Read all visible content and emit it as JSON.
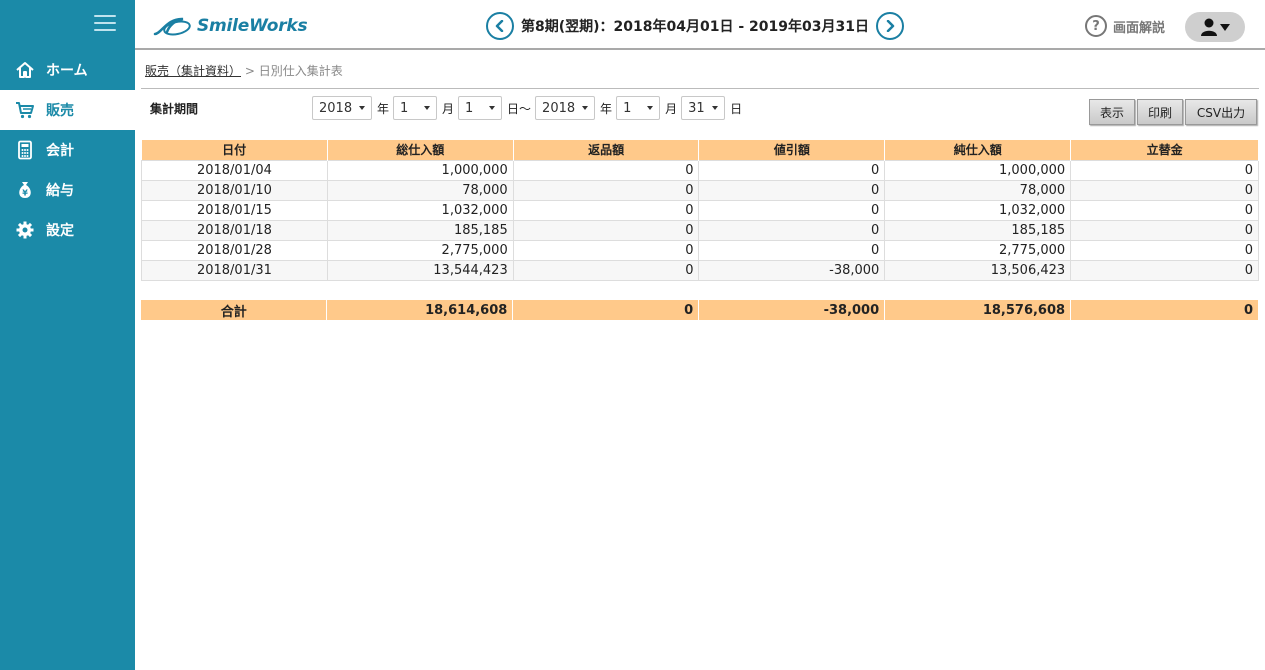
{
  "colors": {
    "sidebar": "#1b8aa8",
    "accent": "#1a7fa3",
    "table_header": "#ffc98a"
  },
  "brand": "SmileWorks",
  "period": "第8期(翌期)：2018年04月01日 - 2019年03月31日",
  "help_label": "画面解説",
  "nav": [
    {
      "label": "ホーム",
      "icon": "home-icon"
    },
    {
      "label": "販売",
      "icon": "cart-icon",
      "active": true
    },
    {
      "label": "会計",
      "icon": "calculator-icon"
    },
    {
      "label": "給与",
      "icon": "money-bag-icon"
    },
    {
      "label": "設定",
      "icon": "gear-icon"
    }
  ],
  "breadcrumb": {
    "parent": "販売（集計資料）",
    "sep": " > ",
    "current": "日別仕入集計表"
  },
  "filter": {
    "label": "集計期間",
    "from_year": "2018",
    "year_unit": "年",
    "from_month": "1",
    "month_unit": "月",
    "from_day": "1",
    "day_unit_range": "日〜",
    "to_year": "2018",
    "to_month": "1",
    "to_day": "31",
    "day_unit": "日"
  },
  "buttons": {
    "show": "表示",
    "print": "印刷",
    "csv": "CSV出力"
  },
  "table": {
    "headers": [
      "日付",
      "総仕入額",
      "返品額",
      "値引額",
      "純仕入額",
      "立替金"
    ],
    "rows": [
      [
        "2018/01/04",
        "1,000,000",
        "0",
        "0",
        "1,000,000",
        "0"
      ],
      [
        "2018/01/10",
        "78,000",
        "0",
        "0",
        "78,000",
        "0"
      ],
      [
        "2018/01/15",
        "1,032,000",
        "0",
        "0",
        "1,032,000",
        "0"
      ],
      [
        "2018/01/18",
        "185,185",
        "0",
        "0",
        "185,185",
        "0"
      ],
      [
        "2018/01/28",
        "2,775,000",
        "0",
        "0",
        "2,775,000",
        "0"
      ],
      [
        "2018/01/31",
        "13,544,423",
        "0",
        "-38,000",
        "13,506,423",
        "0"
      ]
    ],
    "total": [
      "合計",
      "18,614,608",
      "0",
      "-38,000",
      "18,576,608",
      "0"
    ]
  }
}
